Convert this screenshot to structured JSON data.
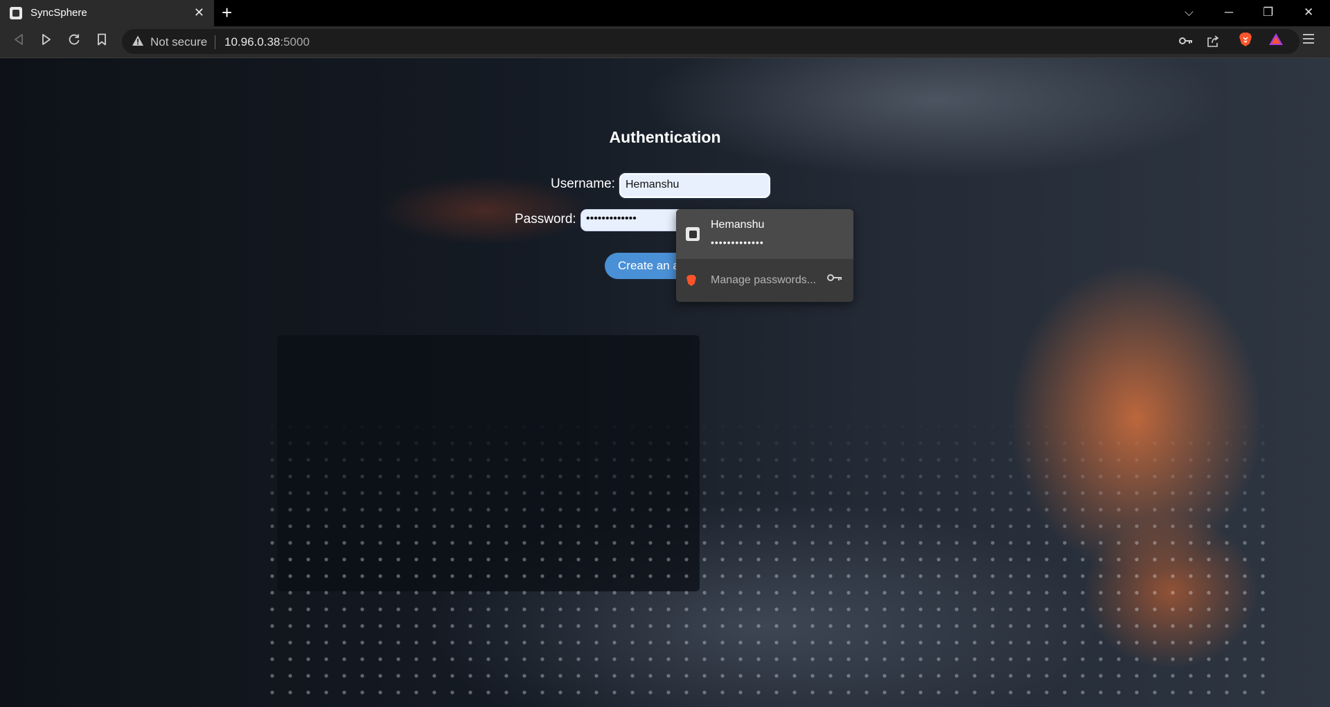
{
  "browser": {
    "tab": {
      "title": "SyncSphere",
      "close_glyph": "✕"
    },
    "new_tab_glyph": "+",
    "window_controls": {
      "tab_search": "⌵",
      "minimize": "─",
      "restore": "❐",
      "close": "✕"
    },
    "omnibox": {
      "security_text": "Not secure",
      "url_host": "10.96.0.38",
      "url_port": ":5000"
    },
    "icons": {
      "back": "back-icon",
      "forward": "forward-icon",
      "reload": "reload-icon",
      "bookmark": "bookmark-icon",
      "key": "key-icon",
      "share": "share-icon",
      "brave_shields": "brave-shields-icon",
      "brave_rewards": "brave-rewards-icon",
      "menu": "hamburger-menu-icon"
    },
    "colors": {
      "brave_orange": "#fb542b",
      "rewards_purple": "#a83dd9"
    }
  },
  "page": {
    "title": "Authentication",
    "username_label": "Username:",
    "username_value": "Hemanshu",
    "password_label": "Password:",
    "password_value": "•••••••••••••",
    "create_button_label": "Create an account",
    "button_color": "#4a90d6"
  },
  "autofill": {
    "saved_username": "Hemanshu",
    "saved_password_mask": "•••••••••••••",
    "manage_label": "Manage passwords..."
  }
}
